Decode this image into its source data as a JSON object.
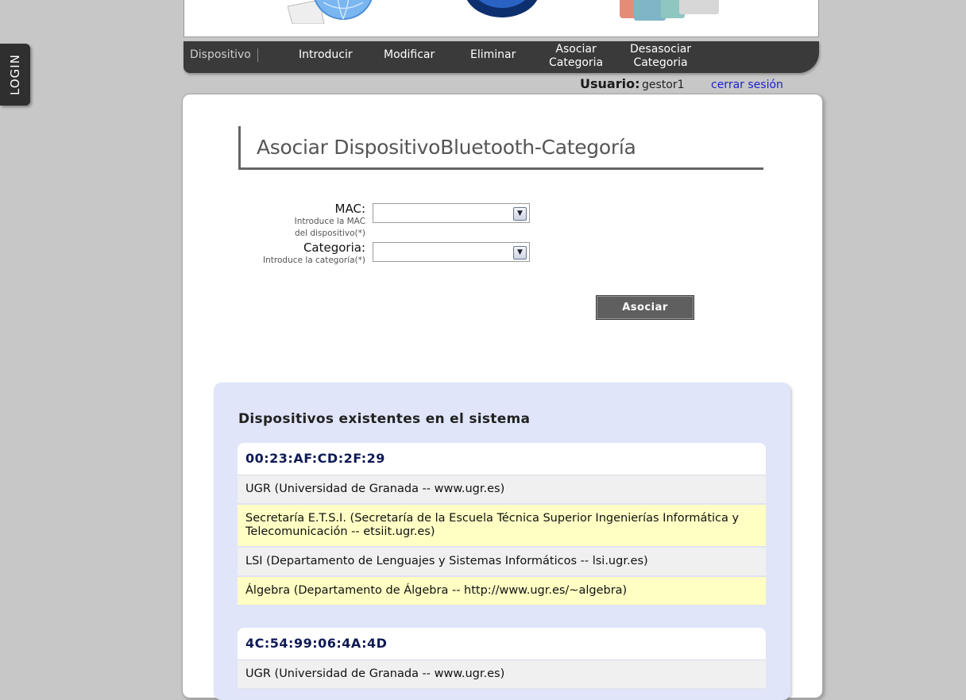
{
  "login": {
    "label": "LOGIN"
  },
  "nav": {
    "items": [
      {
        "label": "Dispositivo"
      },
      {
        "label": "Introducir"
      },
      {
        "label": "Modificar"
      },
      {
        "label": "Eliminar"
      },
      {
        "label": "Asociar\nCategoria"
      },
      {
        "label": "Desasociar\nCategoria"
      }
    ]
  },
  "user": {
    "label": "Usuario:",
    "name": "gestor1",
    "logout": "cerrar sesión"
  },
  "form": {
    "title": "Asociar DispositivoBluetooth-Categoría",
    "mac": {
      "label": "MAC:",
      "hint": "Introduce la MAC del dispositivo(*)",
      "value": ""
    },
    "categoria": {
      "label": "Categoria:",
      "hint": "Introduce la categoría(*)",
      "value": ""
    },
    "submit_label": "Asociar"
  },
  "devices": {
    "heading": "Dispositivos existentes en el sistema",
    "list": [
      {
        "mac": "00:23:AF:CD:2F:29",
        "categories": [
          "UGR (Universidad de Granada -- www.ugr.es)",
          "Secretaría E.T.S.I. (Secretaría de la Escuela Técnica Superior Ingenierías Informática y Telecomunicación -- etsiit.ugr.es)",
          "LSI (Departamento de Lenguajes y Sistemas Informáticos -- lsi.ugr.es)",
          "Álgebra (Departamento de Álgebra -- http://www.ugr.es/~algebra)"
        ]
      },
      {
        "mac": "4C:54:99:06:4A:4D",
        "categories": [
          "UGR (Universidad de Granada -- www.ugr.es)"
        ]
      }
    ]
  },
  "colors": {
    "background": "#c7c7c7",
    "navbar": "#3a3a3a",
    "list_panel": "#e0e5fa",
    "row_highlight": "#ffffc4",
    "link": "#1b22cc"
  }
}
